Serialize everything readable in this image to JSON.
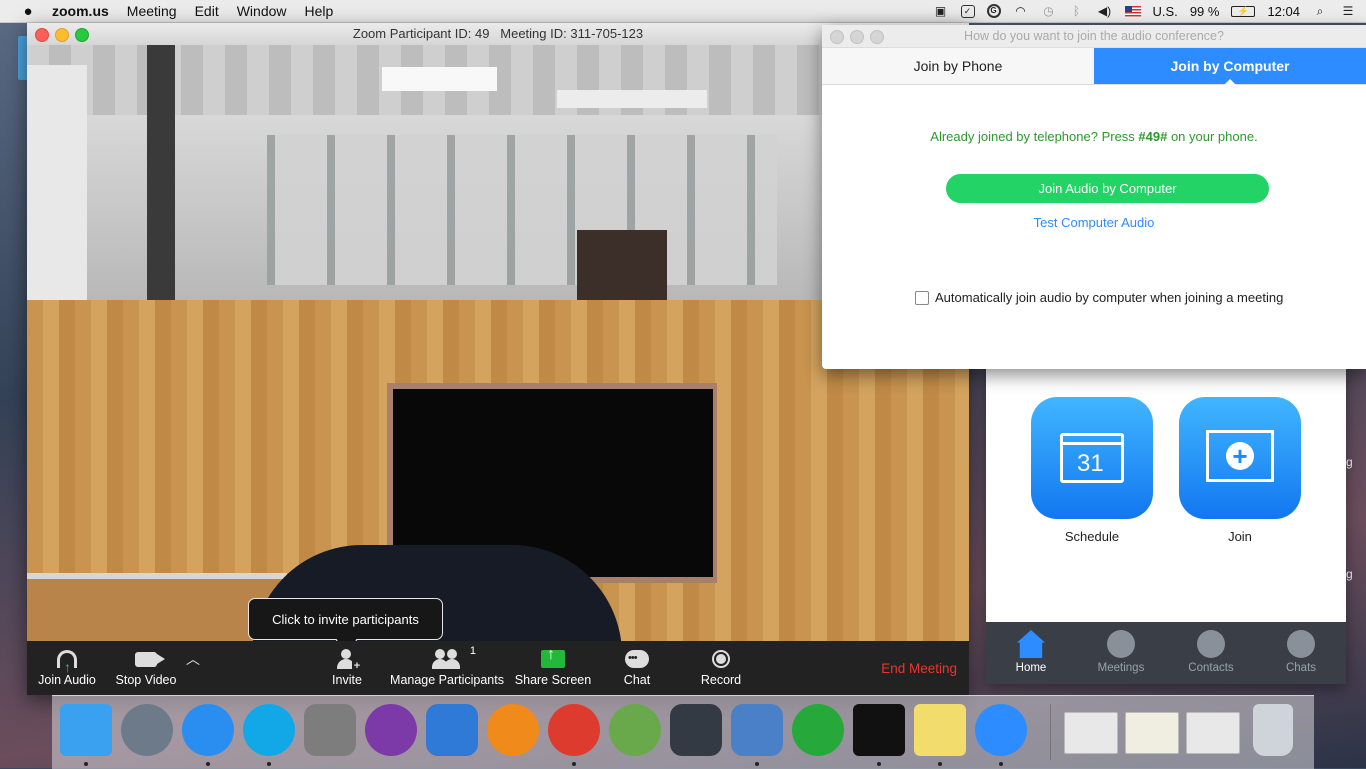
{
  "menubar": {
    "app_name": "zoom.us",
    "menus": [
      "Meeting",
      "Edit",
      "Window",
      "Help"
    ],
    "input_source": "U.S.",
    "battery": "99 %",
    "clock": "12:04"
  },
  "zoom_window": {
    "title": "Zoom Participant ID: 49   Meeting ID: 311-705-123",
    "tooltip": "Click to invite participants",
    "toolbar": {
      "join_audio": "Join Audio",
      "stop_video": "Stop Video",
      "invite": "Invite",
      "manage_participants": "Manage Participants",
      "participant_count": "1",
      "share_screen": "Share Screen",
      "chat": "Chat",
      "record": "Record",
      "end_meeting": "End Meeting"
    }
  },
  "audio_dialog": {
    "title": "How do you want to join the audio conference?",
    "tabs": [
      {
        "label": "Join by Phone",
        "active": false
      },
      {
        "label": "Join by Computer",
        "active": true
      }
    ],
    "already_joined_prefix": "Already joined by telephone? Press ",
    "already_joined_code": "#49#",
    "already_joined_suffix": " on your phone.",
    "join_button": "Join Audio by Computer",
    "test_link": "Test Computer Audio",
    "auto_join_label": "Automatically join audio by computer when joining a meeting",
    "auto_join_checked": false
  },
  "zoom_home": {
    "tiles": [
      {
        "label": "Schedule",
        "icon": "calendar-icon",
        "calendar_day": "31"
      },
      {
        "label": "Join",
        "icon": "join-plus-icon"
      }
    ],
    "nav": [
      {
        "label": "Home",
        "active": true
      },
      {
        "label": "Meetings",
        "active": false
      },
      {
        "label": "Contacts",
        "active": false
      },
      {
        "label": "Chats",
        "active": false
      }
    ],
    "side_text_1": "g",
    "side_text_2": "g"
  },
  "dock": {
    "apps": [
      {
        "name": "finder-icon",
        "color": "#3aa0f0",
        "running": true
      },
      {
        "name": "launchpad-icon",
        "color": "#6c7a8a",
        "running": false
      },
      {
        "name": "safari-icon",
        "color": "#2a8df0",
        "running": true
      },
      {
        "name": "skype-icon",
        "color": "#12a8e8",
        "running": true
      },
      {
        "name": "system-preferences-icon",
        "color": "#7d7d7d",
        "running": false
      },
      {
        "name": "globe-app-icon",
        "color": "#7c3aa8",
        "running": false
      },
      {
        "name": "xcode-icon",
        "color": "#2f7ad6",
        "running": false
      },
      {
        "name": "ibooks-icon",
        "color": "#f08a1a",
        "running": false
      },
      {
        "name": "chrome-icon",
        "color": "#dc3b2e",
        "running": true
      },
      {
        "name": "android-studio-icon",
        "color": "#69a94b",
        "running": false
      },
      {
        "name": "media-app-icon",
        "color": "#333a44",
        "running": false
      },
      {
        "name": "preview-icon",
        "color": "#4a80c8",
        "running": true
      },
      {
        "name": "network-radar-icon",
        "color": "#26a83a",
        "running": false
      },
      {
        "name": "terminal-icon",
        "color": "#111111",
        "running": true
      },
      {
        "name": "notes-icon",
        "color": "#f2dc6b",
        "running": true
      },
      {
        "name": "zoom-icon",
        "color": "#2d8cff",
        "running": true
      },
      {
        "name": "window-thumbnail-1",
        "color": "#e8e8e8",
        "running": false
      },
      {
        "name": "window-thumbnail-2",
        "color": "#f0eee0",
        "running": false
      },
      {
        "name": "window-thumbnail-3",
        "color": "#e8e8e8",
        "running": false
      },
      {
        "name": "trash-icon",
        "color": "#cfd4da",
        "running": false
      }
    ]
  }
}
